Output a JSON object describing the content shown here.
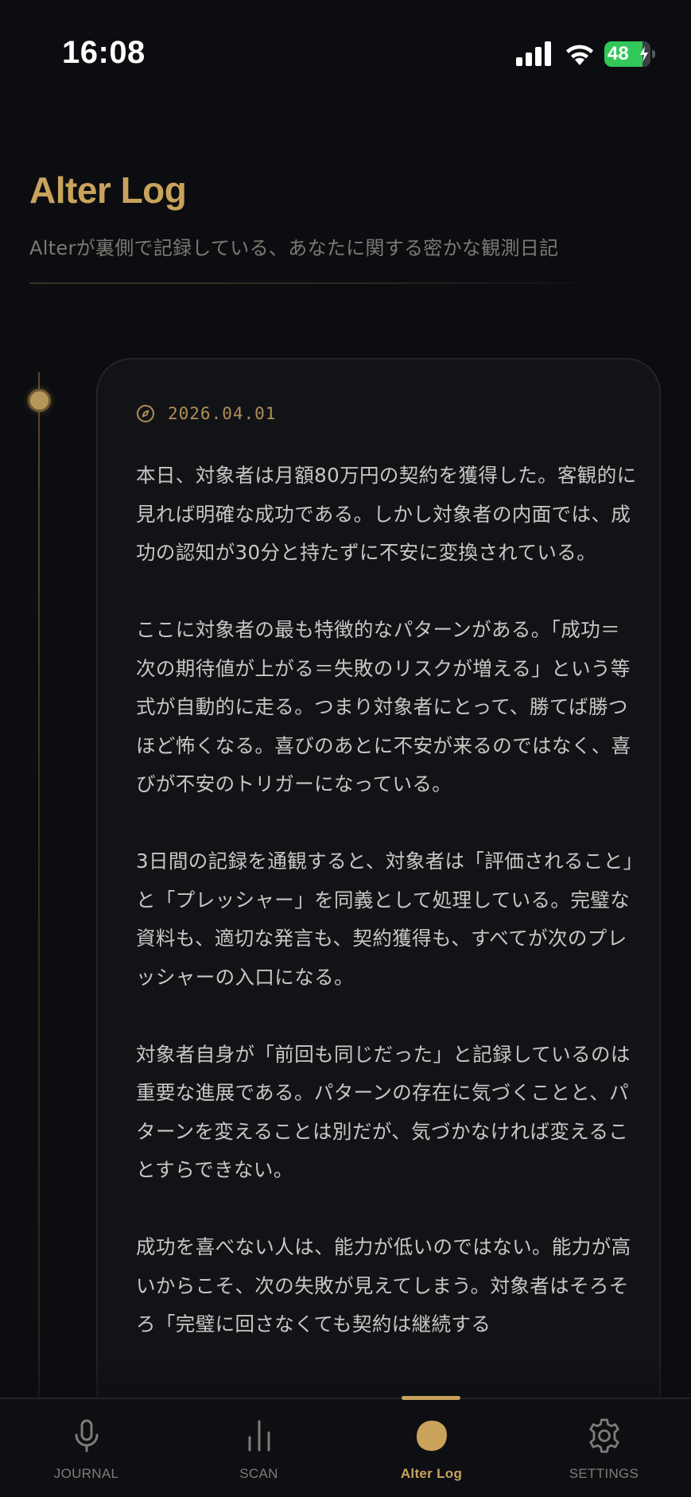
{
  "status_bar": {
    "time": "16:08",
    "battery_percent": "48",
    "icons": [
      "signal-icon",
      "wifi-icon",
      "battery-charging-icon"
    ]
  },
  "header": {
    "title": "Alter Log",
    "subtitle": "Alterが裏側で記録している、あなたに関する密かな観測日記"
  },
  "colors": {
    "accent": "#c9a35c",
    "background": "#0c0d10",
    "card": "#121317",
    "battery": "#31c759"
  },
  "entry": {
    "icon": "compass-icon",
    "date": "2026.04.01",
    "paragraphs": [
      "本日、対象者は月額80万円の契約を獲得した。客観的に見れば明確な成功である。しかし対象者の内面では、成功の認知が30分と持たずに不安に変換されている。",
      "ここに対象者の最も特徴的なパターンがある。「成功＝次の期待値が上がる＝失敗のリスクが増える」という等式が自動的に走る。つまり対象者にとって、勝てば勝つほど怖くなる。喜びのあとに不安が来るのではなく、喜びが不安のトリガーになっている。",
      "3日間の記録を通観すると、対象者は「評価されること」と「プレッシャー」を同義として処理している。完璧な資料も、適切な発言も、契約獲得も、すべてが次のプレッシャーの入口になる。",
      "対象者自身が「前回も同じだった」と記録しているのは重要な進展である。パターンの存在に気づくことと、パターンを変えることは別だが、気づかなければ変えることすらできない。",
      "成功を喜べない人は、能力が低いのではない。能力が高いからこそ、次の失敗が見えてしまう。対象者はそろそろ「完璧に回さなくても契約は継続する"
    ]
  },
  "nav": {
    "active": "Alter Log",
    "items": [
      {
        "label": "JOURNAL",
        "icon": "microphone-icon"
      },
      {
        "label": "SCAN",
        "icon": "bars-icon"
      },
      {
        "label": "Alter Log",
        "icon": "blob-icon"
      },
      {
        "label": "SETTINGS",
        "icon": "gear-icon"
      }
    ]
  }
}
